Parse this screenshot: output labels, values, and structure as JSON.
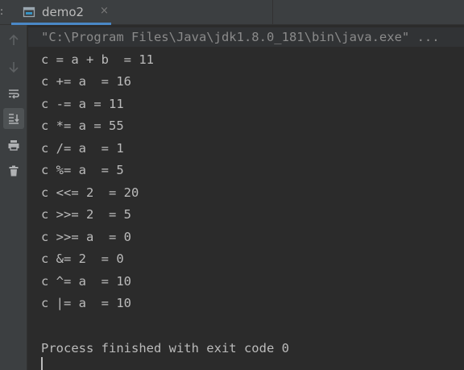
{
  "tab": {
    "edge_mark": ":",
    "label": "demo2",
    "close_glyph": "×"
  },
  "gutter": {
    "icons": [
      "up-arrow-icon",
      "down-arrow-icon",
      "soft-wrap-icon",
      "scroll-to-end-icon",
      "print-icon",
      "trash-icon"
    ]
  },
  "console": {
    "command": "\"C:\\Program Files\\Java\\jdk1.8.0_181\\bin\\java.exe\" ...",
    "lines": [
      "c = a + b  = 11",
      "c += a  = 16",
      "c -= a = 11",
      "c *= a = 55",
      "c /= a  = 1",
      "c %= a  = 5",
      "c <<= 2  = 20",
      "c >>= 2  = 5",
      "c >>= a  = 0",
      "c &= 2  = 0",
      "c ^= a  = 10",
      "c |= a  = 10"
    ],
    "exit_message": "Process finished with exit code 0"
  },
  "colors": {
    "background": "#2b2b2b",
    "panel": "#3c3f41",
    "text": "#bbbbbb",
    "command_text": "#8a8a8a",
    "tab_accent": "#4a88c7"
  }
}
